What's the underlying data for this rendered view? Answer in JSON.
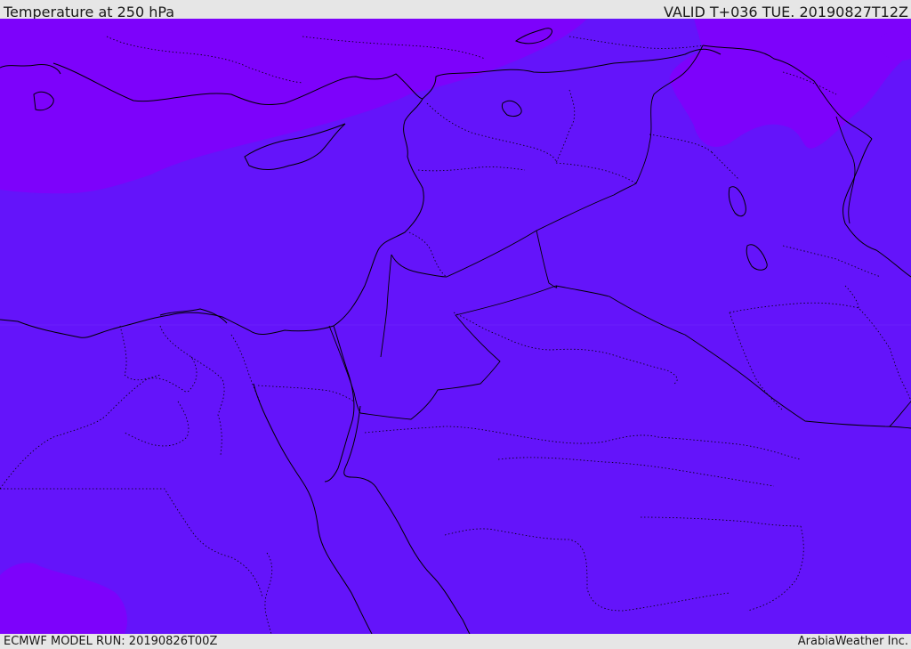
{
  "header": {
    "title": "Temperature at 250 hPa",
    "valid": "VALID T+036 TUE. 20190827T12Z"
  },
  "footer": {
    "model_run": "ECMWF MODEL RUN: 20190826T00Z",
    "credit": "ArabiaWeather Inc."
  },
  "map": {
    "field": "temperature",
    "level": "250 hPa",
    "colors": {
      "dominant_fill": "#6414fa",
      "cooler_fill": "#7d02fb",
      "boundary_line": "#000000",
      "header_background": "#e6e6e6"
    }
  }
}
